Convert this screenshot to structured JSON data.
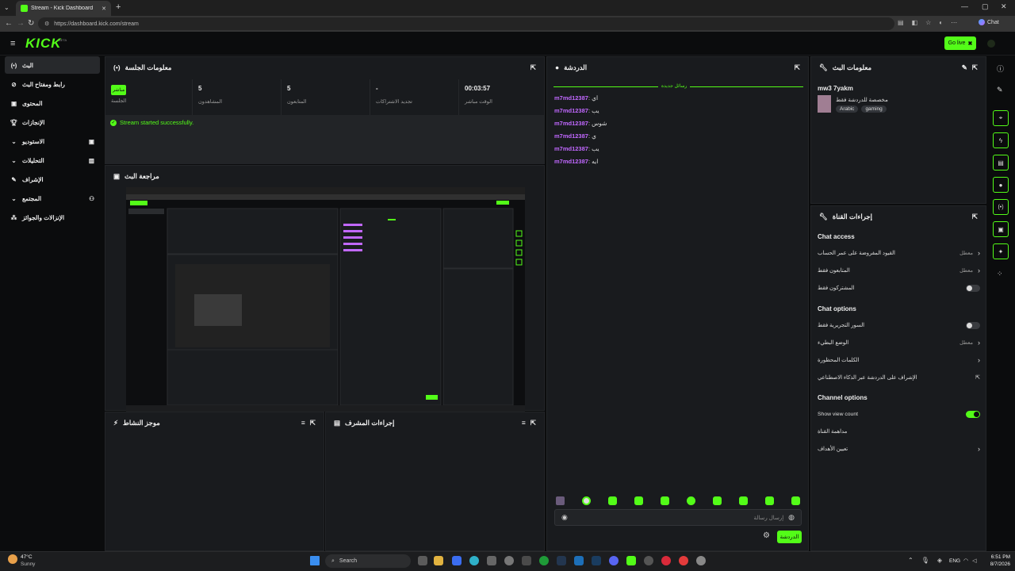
{
  "browser": {
    "tab_title": "Stream - Kick Dashboard",
    "url": "https://dashboard.kick.com/stream",
    "chat_label": "Chat"
  },
  "header": {
    "logo_text": "KICK",
    "logo_badge": "BETA",
    "go_live_label": "Go live"
  },
  "nav": {
    "items": [
      {
        "label": "البث",
        "icon": "broadcast-icon"
      },
      {
        "label": "رابط ومفتاح البث",
        "icon": "link-icon"
      },
      {
        "label": "المحتوى",
        "icon": "content-icon"
      },
      {
        "label": "الإنجازات",
        "icon": "trophy-icon"
      },
      {
        "label": "الاستوديو",
        "icon": "studio-icon"
      },
      {
        "label": "التحليلات",
        "icon": "analytics-icon"
      },
      {
        "label": "الإشراف",
        "icon": "moderation-icon"
      },
      {
        "label": "المجتمع",
        "icon": "community-icon"
      },
      {
        "label": "الإنزالات والجوائز",
        "icon": "drops-icon"
      }
    ]
  },
  "session": {
    "title": "معلومات الجلسة",
    "badge": "مباشر",
    "session_label": "الجلسة",
    "stats": [
      {
        "value": "5",
        "label": "المشاهدون"
      },
      {
        "value": "5",
        "label": "المتابعون"
      },
      {
        "value": "-",
        "label": "تجديد الاشتراكات"
      },
      {
        "value": "00:03:57",
        "label": "الوقت مباشر"
      }
    ],
    "status_message": "Stream started successfully."
  },
  "preview": {
    "title": "مراجعة البث"
  },
  "activity": {
    "title": "موجز النشاط"
  },
  "modactions": {
    "title": "إجراءات المشرف"
  },
  "chat": {
    "title": "الدردشة",
    "new_messages": "رسائل جديدة",
    "messages": [
      {
        "user": "m7md12387",
        "text": "اي"
      },
      {
        "user": "m7md12387",
        "text": "يب"
      },
      {
        "user": "m7md12387",
        "text": "شوس"
      },
      {
        "user": "m7md12387",
        "text": "ي"
      },
      {
        "user": "m7md12387",
        "text": "يب"
      },
      {
        "user": "m7md12387",
        "text": "ايه"
      }
    ],
    "input_placeholder": "إرسال رسالة",
    "send_label": "الدردشة"
  },
  "stream_info": {
    "title": "معلومات البث",
    "stream_title": "mw3 7yakm",
    "category": "مخصصة للدردشة فقط",
    "tags": [
      "Arabic",
      "gaming"
    ]
  },
  "channel_settings": {
    "title": "إجراءات القناة",
    "chat_access": {
      "heading": "Chat access",
      "rows": [
        {
          "label": "القيود المفروضة على عمر الحساب",
          "value": "معطل"
        },
        {
          "label": "المتابعون فقط",
          "value": "معطل"
        },
        {
          "label": "المشتركون فقط",
          "value": ""
        }
      ]
    },
    "chat_options": {
      "heading": "Chat options",
      "rows": [
        {
          "label": "السور التجريرية فقط",
          "value": ""
        },
        {
          "label": "الوضع البطيء",
          "value": "معطل"
        },
        {
          "label": "الكلمات المحظورة",
          "value": ""
        },
        {
          "label": "الإشراف على الدردشة عبر الذكاء الاصطناعي",
          "value": ""
        }
      ]
    },
    "channel_options": {
      "heading": "Channel options",
      "rows": [
        {
          "label": "Show view count",
          "value": ""
        },
        {
          "label": "مداهمة القناة",
          "value": ""
        },
        {
          "label": "تعيين الأهداف",
          "value": ""
        }
      ]
    }
  },
  "colors": {
    "accent": "#53fc18",
    "username": "#c168ff",
    "panel": "#191b1e",
    "background": "#0b0c0d"
  },
  "taskbar": {
    "weather_temp": "47°C",
    "weather_desc": "Sunny",
    "search_placeholder": "Search",
    "language": "ENG",
    "time": "6:51 PM",
    "date": "8/7/2026"
  }
}
